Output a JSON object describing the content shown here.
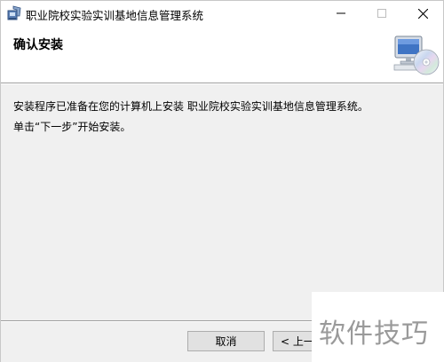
{
  "window": {
    "title": "职业院校实验实训基地信息管理系统"
  },
  "titlebar": {
    "icon": "installer-icon",
    "minimize_glyph": "—",
    "maximize_glyph": "☐",
    "close_glyph": "✕"
  },
  "header": {
    "title": "确认安装",
    "graphic": "computer-cd-icon"
  },
  "content": {
    "line1": "安装程序已准备在您的计算机上安装 职业院校实验实训基地信息管理系统。",
    "line2": "单击“下一步”开始安装。"
  },
  "footer": {
    "cancel_label": "取消",
    "back_label": "< 上一"
  },
  "watermark": {
    "text": "软件技巧"
  }
}
